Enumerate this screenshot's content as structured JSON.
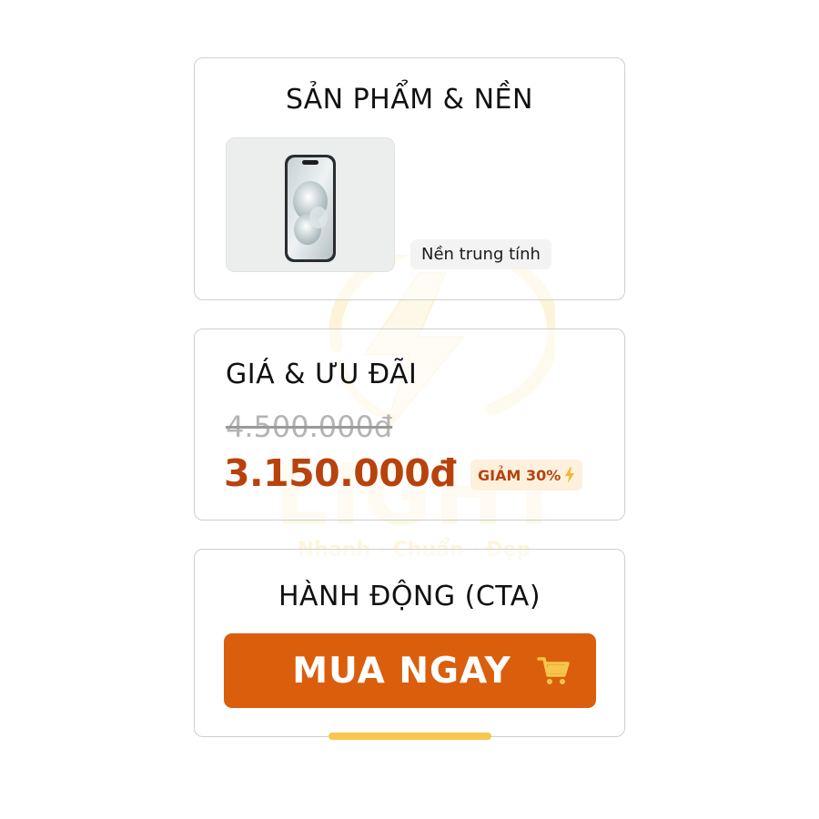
{
  "watermark": {
    "word": "LIGHT",
    "tagline": "Nhanh - Chuẩn - Đẹp"
  },
  "product_section": {
    "title": "SẢN PHẨM & NỀN",
    "background_label": "Nền trung tính"
  },
  "price_section": {
    "title": "GIÁ & ƯU ĐÃI",
    "old_price": "4.500.000đ",
    "new_price": "3.150.000đ",
    "discount_label": "GIẢM 30%"
  },
  "cta_section": {
    "title": "HÀNH ĐỘNG (CTA)",
    "button_label": "MUA NGAY"
  },
  "icons": {
    "discount": "lightning-bolt-icon",
    "cta": "shopping-cart-icon"
  },
  "colors": {
    "accent": "#db5e0c",
    "price": "#b8420d",
    "badge_bg": "#fdf1dd",
    "indicator": "#f7c64c"
  }
}
